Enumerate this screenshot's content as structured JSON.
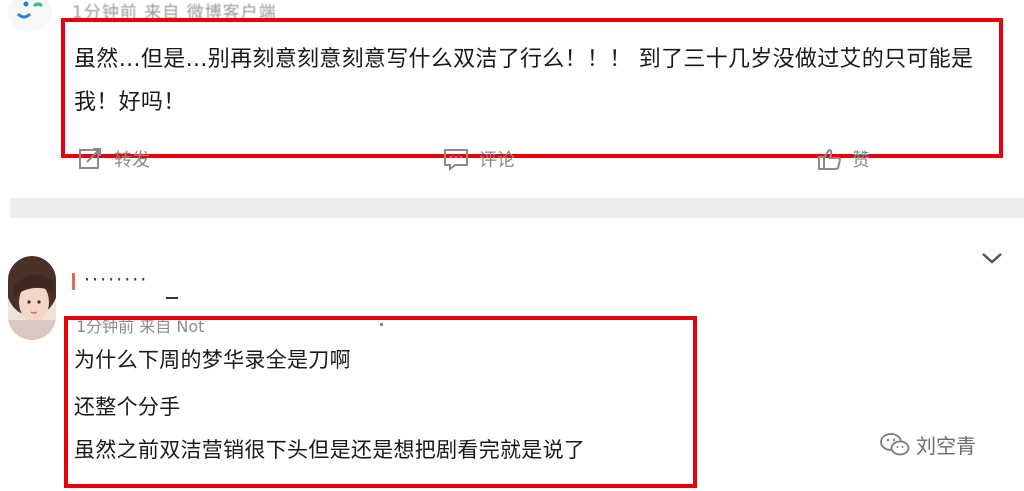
{
  "post1": {
    "meta": "1分钟前 来自 微博客户端",
    "text": "虽然…但是…别再刻意刻意刻意写什么双洁了行么！！！ 到了三十几岁没做过艾的只可能是我！好吗！",
    "actions": {
      "repost": "转发",
      "comment": "评论",
      "like": "赞"
    }
  },
  "post2": {
    "username": "········",
    "meta": "1分钟前 来自 Not",
    "lines": [
      "为什么下周的梦华录全是刀啊",
      "还整个分手",
      "虽然之前双洁营销很下头但是还是想把剧看完就是说了"
    ]
  },
  "watermark": {
    "text": "刘空青"
  },
  "colors": {
    "highlight_box": "#e8000b",
    "divider": "#eeeeee",
    "meta_text": "#8c8c8c"
  }
}
